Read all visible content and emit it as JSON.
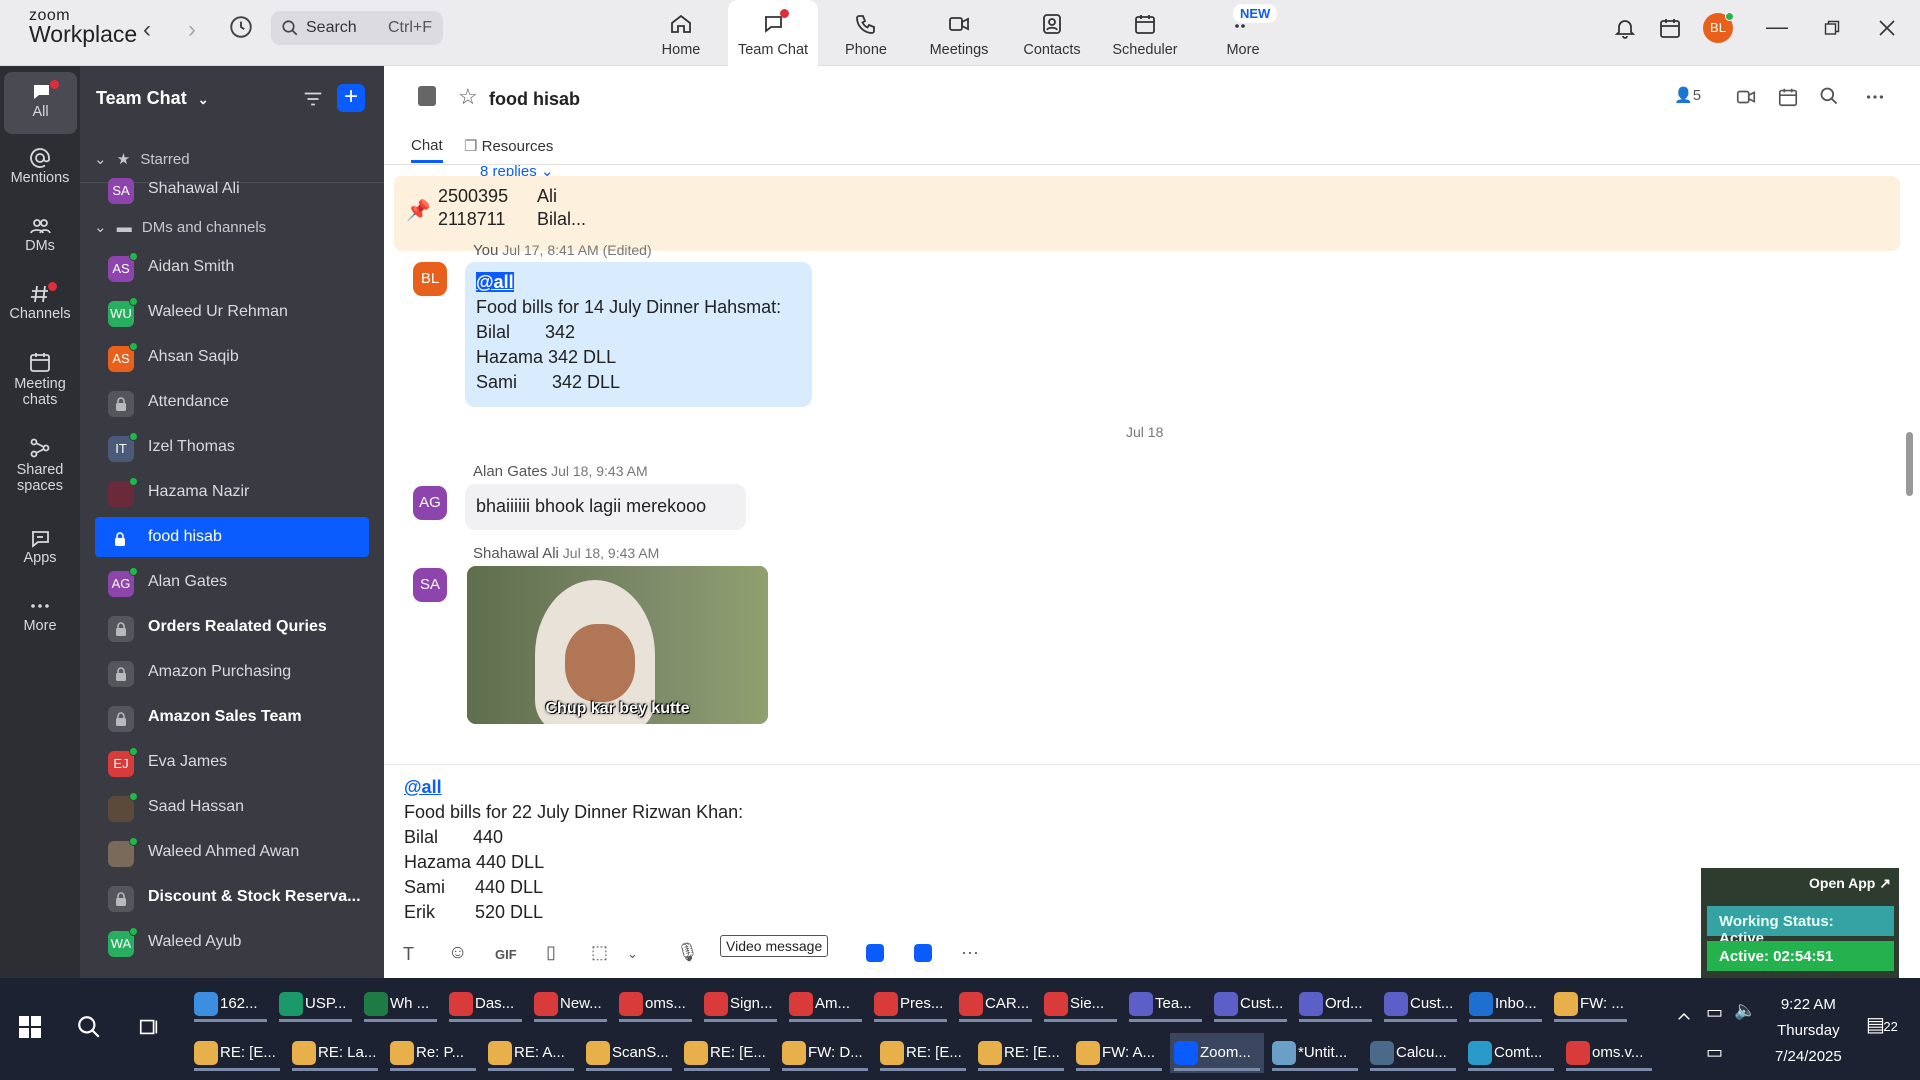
{
  "app": {
    "logo_line1": "zoom",
    "logo_line2": "Workplace"
  },
  "search": {
    "placeholder": "Search",
    "shortcut": "Ctrl+F"
  },
  "nav_tabs": [
    {
      "label": "Home",
      "icon": "home-icon"
    },
    {
      "label": "Team Chat",
      "icon": "chat-icon",
      "active": true
    },
    {
      "label": "Phone",
      "icon": "phone-icon"
    },
    {
      "label": "Meetings",
      "icon": "video-icon"
    },
    {
      "label": "Contacts",
      "icon": "contacts-icon"
    },
    {
      "label": "Scheduler",
      "icon": "calendar-icon"
    },
    {
      "label": "More",
      "icon": "more-icon",
      "badge": "NEW"
    }
  ],
  "user": {
    "initials": "BL"
  },
  "rail": [
    {
      "label": "All",
      "icon": "chat-icon"
    },
    {
      "label": "Mentions",
      "icon": "at-icon"
    },
    {
      "label": "DMs",
      "icon": "people-icon"
    },
    {
      "label": "Channels",
      "icon": "hash-icon"
    },
    {
      "label": "Meeting chats",
      "icon": "calendar-icon"
    },
    {
      "label": "Shared spaces",
      "icon": "share-icon"
    },
    {
      "label": "Apps",
      "icon": "apps-icon"
    },
    {
      "label": "More",
      "icon": "dots-icon"
    }
  ],
  "sidebar": {
    "title": "Team Chat",
    "starred_label": "Starred",
    "dms_label": "DMs and channels",
    "items": [
      {
        "name": "Shahawal Ali",
        "initials": "SA",
        "color": "#8e44ad"
      },
      {
        "name": "Aidan Smith",
        "initials": "AS",
        "color": "#8e44ad"
      },
      {
        "name": "Waleed Ur Rehman",
        "initials": "WU",
        "color": "#27ae60"
      },
      {
        "name": "Ahsan Saqib",
        "initials": "AS",
        "color": "#e8601c"
      },
      {
        "name": "Attendance",
        "lock": true
      },
      {
        "name": "Izel Thomas",
        "initials": "IT",
        "color": "#4a5a78"
      },
      {
        "name": "Hazama Nazir",
        "initials": "",
        "color": "#6b2a3a"
      },
      {
        "name": "food hisab",
        "lock": true,
        "selected": true
      },
      {
        "name": "Alan Gates",
        "initials": "AG",
        "color": "#8e44ad"
      },
      {
        "name": "Orders Realated Quries",
        "lock": true,
        "bold": true
      },
      {
        "name": "Amazon Purchasing",
        "lock": true
      },
      {
        "name": "Amazon Sales Team",
        "lock": true,
        "bold": true
      },
      {
        "name": "Eva James",
        "initials": "EJ",
        "color": "#d93a3a"
      },
      {
        "name": "Saad Hassan",
        "initials": "",
        "color": "#5b4a3a"
      },
      {
        "name": "Waleed Ahmed Awan",
        "initials": "",
        "color": "#7a6a5a"
      },
      {
        "name": "Discount & Stock Reserva...",
        "lock": true,
        "bold": true
      },
      {
        "name": "Waleed Ayub",
        "initials": "WA",
        "color": "#27ae60"
      }
    ]
  },
  "channel": {
    "title": "food hisab",
    "member_count": "5",
    "tabs": [
      "Chat",
      "Resources"
    ]
  },
  "pinned": {
    "replies": "8 replies",
    "line1_num": "2500395",
    "line1_name": "Ali",
    "line2_num": "2118711",
    "line2_name": "Bilal..."
  },
  "messages": [
    {
      "author": "You",
      "time": "Jul 17, 8:41 AM (Edited)",
      "initials": "BL",
      "mention": "@all",
      "lines": [
        "Food bills for 14 July Dinner Hahsmat:",
        "Bilal       342",
        "Hazama 342 DLL",
        "Sami       342 DLL"
      ]
    },
    {
      "date_sep": "Jul 18"
    },
    {
      "author": "Alan Gates",
      "time": "Jul 18, 9:43 AM",
      "initials": "AG",
      "text": "bhaiiiiii bhook lagii merekooo"
    },
    {
      "author": "Shahawal Ali",
      "time": "Jul 18, 9:43 AM",
      "initials": "SA",
      "image_caption": "Chup kar bey kutte"
    }
  ],
  "composer": {
    "mention": "@all",
    "lines": [
      "Food bills for 22 July Dinner Rizwan Khan:",
      "Bilal       440",
      "Hazama 440 DLL",
      "Sami      440 DLL",
      "Erik        520 DLL"
    ],
    "tooltip": "Video message"
  },
  "widget": {
    "open_app": "Open App",
    "status": "Working Status: Active",
    "active_time": "Active: 02:54:51"
  },
  "taskbar": {
    "row1": [
      {
        "label": "162...",
        "color": "#3b8ee0"
      },
      {
        "label": "USP...",
        "color": "#1a9a6a"
      },
      {
        "label": "Wh ...",
        "color": "#1e7b45"
      },
      {
        "label": "Das...",
        "color": "#d93a3a"
      },
      {
        "label": "New...",
        "color": "#d93a3a"
      },
      {
        "label": "oms...",
        "color": "#d93a3a"
      },
      {
        "label": "Sign...",
        "color": "#d93a3a"
      },
      {
        "label": "Am...",
        "color": "#d93a3a"
      },
      {
        "label": "Pres...",
        "color": "#d93a3a"
      },
      {
        "label": "CAR...",
        "color": "#d93a3a"
      },
      {
        "label": "Sie...",
        "color": "#d93a3a"
      },
      {
        "label": "Tea...",
        "color": "#5b5fc7"
      },
      {
        "label": "Cust...",
        "color": "#5b5fc7"
      },
      {
        "label": "Ord...",
        "color": "#5b5fc7"
      },
      {
        "label": "Cust...",
        "color": "#5b5fc7"
      },
      {
        "label": "Inbo...",
        "color": "#1f6fd0"
      },
      {
        "label": "FW: ...",
        "color": "#e8b04a"
      }
    ],
    "row2": [
      {
        "label": "RE: [E...",
        "color": "#e8b04a"
      },
      {
        "label": "RE: La...",
        "color": "#e8b04a"
      },
      {
        "label": "Re: P...",
        "color": "#e8b04a"
      },
      {
        "label": "RE: A...",
        "color": "#e8b04a"
      },
      {
        "label": "ScanS...",
        "color": "#e8b04a"
      },
      {
        "label": "RE: [E...",
        "color": "#e8b04a"
      },
      {
        "label": "FW: D...",
        "color": "#e8b04a"
      },
      {
        "label": "RE: [E...",
        "color": "#e8b04a"
      },
      {
        "label": "RE: [E...",
        "color": "#e8b04a"
      },
      {
        "label": "FW: A...",
        "color": "#e8b04a"
      },
      {
        "label": "Zoom...",
        "color": "#0b5cff"
      },
      {
        "label": "*Untit...",
        "color": "#6aa0c8"
      },
      {
        "label": "Calcu...",
        "color": "#4a6a8a"
      },
      {
        "label": "Comt...",
        "color": "#2a9ac8"
      },
      {
        "label": "oms.v...",
        "color": "#d93a3a"
      }
    ],
    "time": "9:22 AM",
    "day": "Thursday",
    "date": "7/24/2025",
    "notif_count": "22"
  }
}
